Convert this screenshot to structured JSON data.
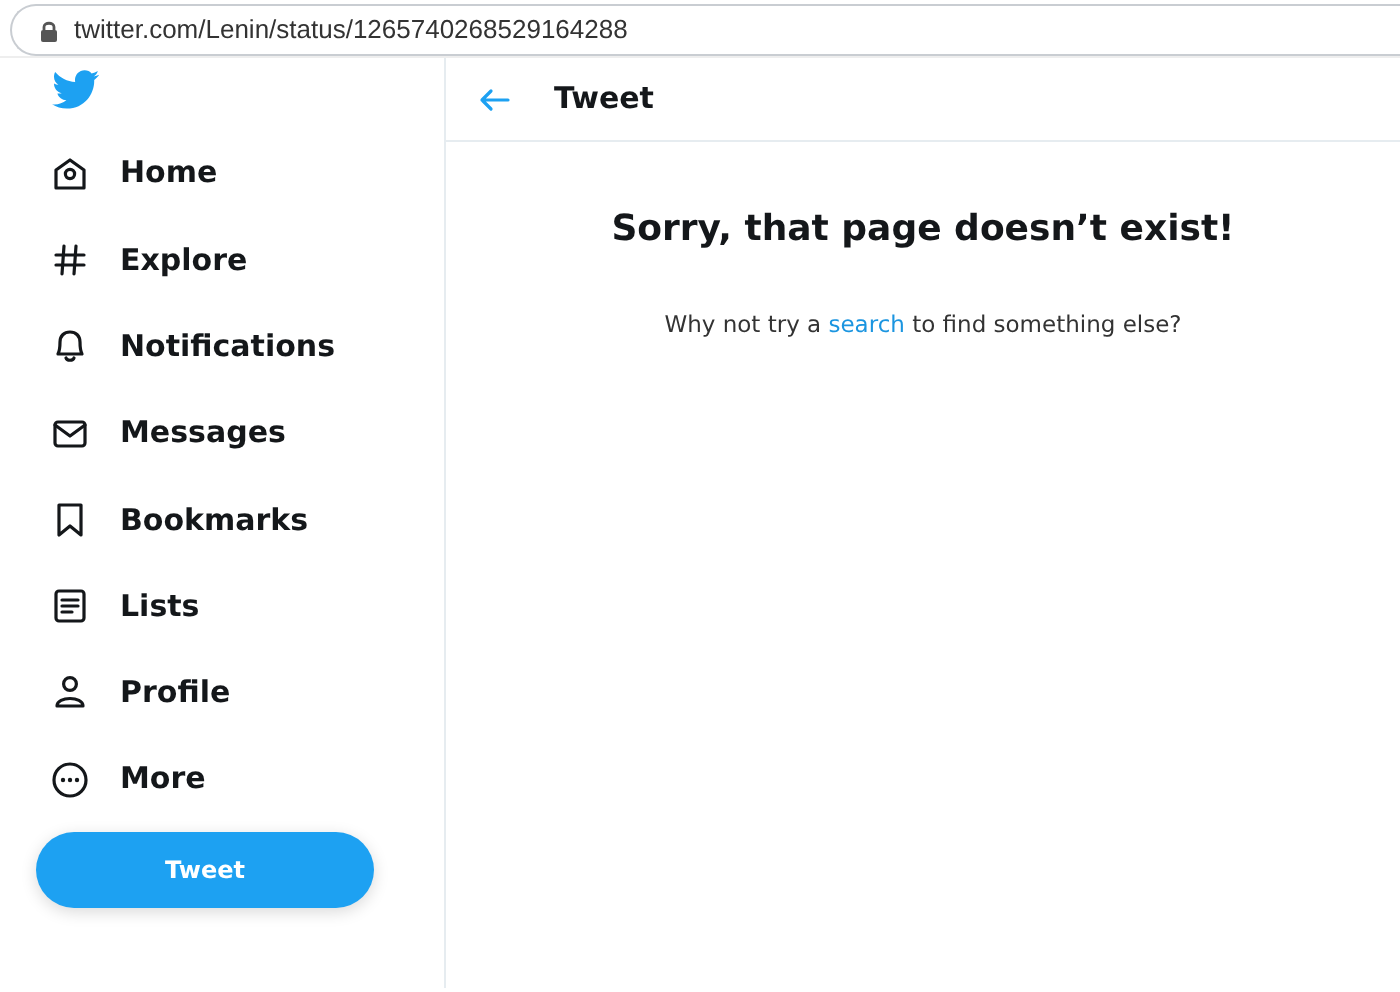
{
  "address_bar": {
    "url": "twitter.com/Lenin/status/1265740268529164288"
  },
  "sidebar": {
    "items": [
      {
        "kind": "home",
        "label": "Home"
      },
      {
        "kind": "explore",
        "label": "Explore"
      },
      {
        "kind": "notifications",
        "label": "Notifications"
      },
      {
        "kind": "messages",
        "label": "Messages"
      },
      {
        "kind": "bookmarks",
        "label": "Bookmarks"
      },
      {
        "kind": "lists",
        "label": "Lists"
      },
      {
        "kind": "profile",
        "label": "Profile"
      },
      {
        "kind": "more",
        "label": "More"
      }
    ],
    "tweet_button": "Tweet"
  },
  "header": {
    "title": "Tweet"
  },
  "error": {
    "heading": "Sorry, that page doesn’t exist!",
    "before": "Why not try a ",
    "link": "search",
    "after": " to find something else?"
  }
}
